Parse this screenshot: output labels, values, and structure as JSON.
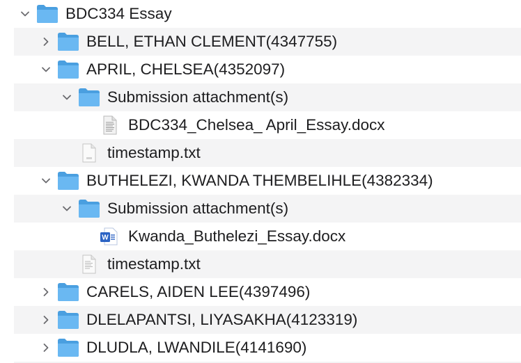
{
  "tree": {
    "root": {
      "label": "BDC334 Essay",
      "icon": "folder-icon",
      "expanded": true
    },
    "rows": [
      {
        "label": "BELL, ETHAN CLEMENT(4347755)",
        "icon": "folder-icon",
        "expanded": false
      },
      {
        "label": "APRIL, CHELSEA(4352097)",
        "icon": "folder-icon",
        "expanded": true
      },
      {
        "label": "Submission attachment(s)",
        "icon": "folder-icon",
        "expanded": true
      },
      {
        "label": "BDC334_Chelsea_ April_Essay.docx",
        "icon": "document-icon"
      },
      {
        "label": "timestamp.txt",
        "icon": "text-file-icon"
      },
      {
        "label": "BUTHELEZI, KWANDA THEMBELIHLE(4382334)",
        "icon": "folder-icon",
        "expanded": true
      },
      {
        "label": "Submission attachment(s)",
        "icon": "folder-icon",
        "expanded": true
      },
      {
        "label": "Kwanda_Buthelezi_Essay.docx",
        "icon": "word-document-icon"
      },
      {
        "label": "timestamp.txt",
        "icon": "text-file-icon"
      },
      {
        "label": "CARELS, AIDEN LEE(4397496)",
        "icon": "folder-icon",
        "expanded": false
      },
      {
        "label": "DLELAPANTSI, LIYASAKHA(4123319)",
        "icon": "folder-icon",
        "expanded": false
      },
      {
        "label": "DLUDLA, LWANDILE(4141690)",
        "icon": "folder-icon",
        "expanded": false
      }
    ]
  },
  "colors": {
    "folder_back": "#4a9fe0",
    "folder_front": "#6ab8f2",
    "stripe": "#f4f4f5",
    "chevron": "#6b6b6f",
    "word_blue": "#2b63c4"
  }
}
